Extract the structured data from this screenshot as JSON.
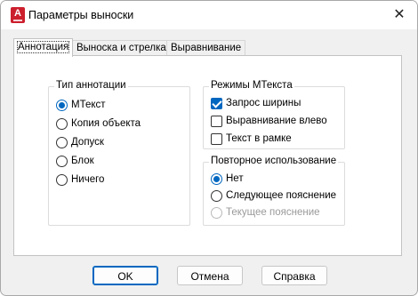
{
  "window": {
    "title": "Параметры выноски"
  },
  "tabs": [
    {
      "label": "Аннотация",
      "active": true
    },
    {
      "label": "Выноска и стрелка",
      "active": false
    },
    {
      "label": "Выравнивание",
      "active": false
    }
  ],
  "annotation_type": {
    "label": "Тип аннотации",
    "options": [
      {
        "label": "МТекст",
        "selected": true
      },
      {
        "label": "Копия объекта",
        "selected": false
      },
      {
        "label": "Допуск",
        "selected": false
      },
      {
        "label": "Блок",
        "selected": false
      },
      {
        "label": "Ничего",
        "selected": false
      }
    ]
  },
  "mtext_modes": {
    "label": "Режимы МТекста",
    "options": [
      {
        "label": "Запрос ширины",
        "checked": true
      },
      {
        "label": "Выравнивание влево",
        "checked": false
      },
      {
        "label": "Текст в рамке",
        "checked": false
      }
    ]
  },
  "reuse": {
    "label": "Повторное использование",
    "options": [
      {
        "label": "Нет",
        "selected": true,
        "disabled": false
      },
      {
        "label": "Следующее пояснение",
        "selected": false,
        "disabled": false
      },
      {
        "label": "Текущее пояснение",
        "selected": false,
        "disabled": true
      }
    ]
  },
  "buttons": {
    "ok": "OK",
    "cancel": "Отмена",
    "help": "Справка"
  },
  "colors": {
    "accent": "#0067c0",
    "app_icon": "#cc1f2d"
  }
}
